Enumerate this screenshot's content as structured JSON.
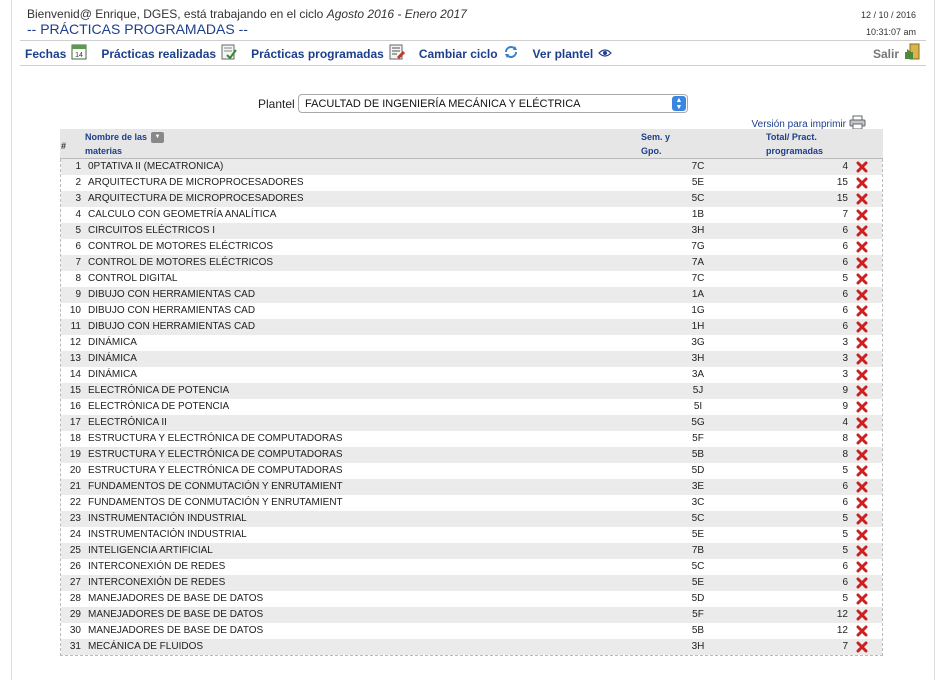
{
  "header": {
    "welcome_prefix": "Bienvenid@ Enrique, DGES, está trabajando en el ciclo",
    "cycle": "Agosto 2016 - Enero 2017",
    "title": "-- PRÁCTICAS PROGRAMADAS --",
    "date": "12 / 10 / 2016",
    "time": "10:31:07 am"
  },
  "nav": {
    "fechas": "Fechas",
    "realizadas": "Prácticas realizadas",
    "programadas": "Prácticas programadas",
    "cambiar": "Cambiar ciclo",
    "plantel": "Ver plantel",
    "salir": "Salir"
  },
  "filter": {
    "plantel_label": "Plantel",
    "plantel_value": "FACULTAD DE INGENIERÍA MECÁNICA Y ELÉCTRICA",
    "print_label": "Versión para imprimir"
  },
  "table": {
    "columns": {
      "num": "#",
      "name_line1": "Nombre de las",
      "name_line2": "materias",
      "sem_line1": "Sem. y",
      "sem_line2": "Gpo.",
      "total_line1": "Total/ Pract.",
      "total_line2": "programadas"
    },
    "rows": [
      {
        "num": "1",
        "name": "0PTATIVA II (MECATRONICA)",
        "group": "7C",
        "total": "4"
      },
      {
        "num": "2",
        "name": "ARQUITECTURA DE MICROPROCESADORES",
        "group": "5E",
        "total": "15"
      },
      {
        "num": "3",
        "name": "ARQUITECTURA DE MICROPROCESADORES",
        "group": "5C",
        "total": "15"
      },
      {
        "num": "4",
        "name": "CALCULO CON GEOMETRÍA ANALÍTICA",
        "group": "1B",
        "total": "7"
      },
      {
        "num": "5",
        "name": "CIRCUITOS ELÉCTRICOS I",
        "group": "3H",
        "total": "6"
      },
      {
        "num": "6",
        "name": "CONTROL DE MOTORES ELÉCTRICOS",
        "group": "7G",
        "total": "6"
      },
      {
        "num": "7",
        "name": "CONTROL DE MOTORES ELÉCTRICOS",
        "group": "7A",
        "total": "6"
      },
      {
        "num": "8",
        "name": "CONTROL DIGITAL",
        "group": "7C",
        "total": "5"
      },
      {
        "num": "9",
        "name": "DIBUJO CON HERRAMIENTAS CAD",
        "group": "1A",
        "total": "6"
      },
      {
        "num": "10",
        "name": "DIBUJO CON HERRAMIENTAS CAD",
        "group": "1G",
        "total": "6"
      },
      {
        "num": "11",
        "name": "DIBUJO CON HERRAMIENTAS CAD",
        "group": "1H",
        "total": "6"
      },
      {
        "num": "12",
        "name": "DINÁMICA",
        "group": "3G",
        "total": "3"
      },
      {
        "num": "13",
        "name": "DINÁMICA",
        "group": "3H",
        "total": "3"
      },
      {
        "num": "14",
        "name": "DINÁMICA",
        "group": "3A",
        "total": "3"
      },
      {
        "num": "15",
        "name": "ELECTRÓNICA DE POTENCIA",
        "group": "5J",
        "total": "9"
      },
      {
        "num": "16",
        "name": "ELECTRÓNICA DE POTENCIA",
        "group": "5I",
        "total": "9"
      },
      {
        "num": "17",
        "name": "ELECTRÓNICA II",
        "group": "5G",
        "total": "4"
      },
      {
        "num": "18",
        "name": "ESTRUCTURA Y ELECTRÓNICA DE COMPUTADORAS",
        "group": "5F",
        "total": "8"
      },
      {
        "num": "19",
        "name": "ESTRUCTURA Y ELECTRÓNICA DE COMPUTADORAS",
        "group": "5B",
        "total": "8"
      },
      {
        "num": "20",
        "name": "ESTRUCTURA Y ELECTRÓNICA DE COMPUTADORAS",
        "group": "5D",
        "total": "5"
      },
      {
        "num": "21",
        "name": "FUNDAMENTOS DE CONMUTACIÓN Y ENRUTAMIENT",
        "group": "3E",
        "total": "6"
      },
      {
        "num": "22",
        "name": "FUNDAMENTOS DE CONMUTACIÓN Y ENRUTAMIENT",
        "group": "3C",
        "total": "6"
      },
      {
        "num": "23",
        "name": "INSTRUMENTACIÓN INDUSTRIAL",
        "group": "5C",
        "total": "5"
      },
      {
        "num": "24",
        "name": "INSTRUMENTACIÓN INDUSTRIAL",
        "group": "5E",
        "total": "5"
      },
      {
        "num": "25",
        "name": "INTELIGENCIA ARTIFICIAL",
        "group": "7B",
        "total": "5"
      },
      {
        "num": "26",
        "name": "INTERCONEXIÓN DE REDES",
        "group": "5C",
        "total": "6"
      },
      {
        "num": "27",
        "name": "INTERCONEXIÓN DE REDES",
        "group": "5E",
        "total": "6"
      },
      {
        "num": "28",
        "name": "MANEJADORES DE BASE DE DATOS",
        "group": "5D",
        "total": "5"
      },
      {
        "num": "29",
        "name": "MANEJADORES DE BASE DE DATOS",
        "group": "5F",
        "total": "12"
      },
      {
        "num": "30",
        "name": "MANEJADORES DE BASE DE DATOS",
        "group": "5B",
        "total": "12"
      },
      {
        "num": "31",
        "name": "MECÁNICA DE FLUIDOS",
        "group": "3H",
        "total": "7"
      }
    ]
  },
  "icons": {
    "fechas": "calendar-icon",
    "realizadas": "checklist-icon",
    "programadas": "edit-list-icon",
    "cambiar": "refresh-cycle-icon",
    "plantel": "eye-icon",
    "salir": "exit-door-icon",
    "print": "printer-icon",
    "delete": "delete-x-icon",
    "sort": "sort-down-icon"
  },
  "colors": {
    "link": "#1c3f8c",
    "delete": "#cc1f1f",
    "row_alt": "#ebebeb"
  }
}
